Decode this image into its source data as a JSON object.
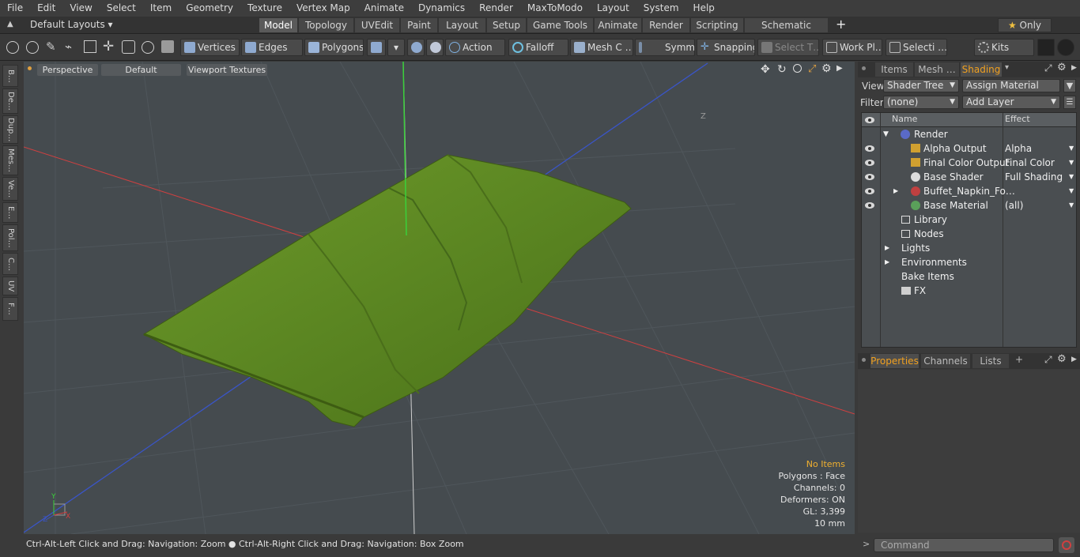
{
  "menu": [
    "File",
    "Edit",
    "View",
    "Select",
    "Item",
    "Geometry",
    "Texture",
    "Vertex Map",
    "Animate",
    "Dynamics",
    "Render",
    "MaxToModo",
    "Layout",
    "System",
    "Help"
  ],
  "layout": {
    "preset": "Default Layouts ▾",
    "tabs": [
      "Model",
      "Topology",
      "UVEdit",
      "Paint",
      "Layout",
      "Setup",
      "Game Tools",
      "Animate",
      "Render",
      "Scripting",
      "Schematic Fusion"
    ],
    "add": "+",
    "only": "Only"
  },
  "toolbar": {
    "vertices": "Vertices",
    "edges": "Edges",
    "polygons": "Polygons",
    "action": "Action",
    "falloff": "Falloff",
    "mesh": "Mesh C …",
    "symm": "Symm …",
    "snapping": "Snapping",
    "select_t": "Select T…",
    "workplane": "Work Pl…",
    "selection": "Selecti …",
    "kits": "Kits"
  },
  "lefttabs": [
    "B…",
    "De…",
    "Dup…",
    "Mes…",
    "Ve…",
    "E…",
    "Pol…",
    "C…",
    "UV",
    "F…"
  ],
  "viewport": {
    "view": "Perspective",
    "shading": "Default",
    "textures": "Viewport Textures",
    "info": {
      "items": "No Items",
      "polygons": "Polygons : Face",
      "channels": "Channels: 0",
      "deformers": "Deformers: ON",
      "gl": "GL: 3,399",
      "scale": "10 mm"
    },
    "axis_z": "Z",
    "gizmo_y": "Y",
    "gizmo_x": "X",
    "gizmo_z": "Z"
  },
  "status": "Ctrl-Alt-Left Click and Drag: Navigation: Zoom ● Ctrl-Alt-Right Click and Drag: Navigation: Box Zoom",
  "right": {
    "tabs": [
      "Items",
      "Mesh …",
      "Shading"
    ],
    "view_label": "View",
    "view_value": "Shader Tree",
    "assign": "Assign Material",
    "filter_label": "Filter",
    "filter_value": "(none)",
    "addlayer": "Add Layer",
    "col_name": "Name",
    "col_effect": "Effect",
    "tree": [
      {
        "name": "Render",
        "effect": ""
      },
      {
        "name": "Alpha Output",
        "effect": "Alpha"
      },
      {
        "name": "Final Color Output",
        "effect": "Final Color"
      },
      {
        "name": "Base Shader",
        "effect": "Full Shading"
      },
      {
        "name": "Buffet_Napkin_Fo…",
        "effect": ""
      },
      {
        "name": "Base Material",
        "effect": "(all)"
      },
      {
        "name": "Library",
        "effect": ""
      },
      {
        "name": "Nodes",
        "effect": ""
      },
      {
        "name": "Lights",
        "effect": ""
      },
      {
        "name": "Environments",
        "effect": ""
      },
      {
        "name": "Bake Items",
        "effect": ""
      },
      {
        "name": "FX",
        "effect": ""
      }
    ],
    "bottom_tabs": [
      "Properties",
      "Channels",
      "Lists",
      "+"
    ],
    "command": "Command"
  },
  "colors": {
    "accent": "#f0a020",
    "mesh": "#5e8a22",
    "viewport": "#454b4f"
  }
}
